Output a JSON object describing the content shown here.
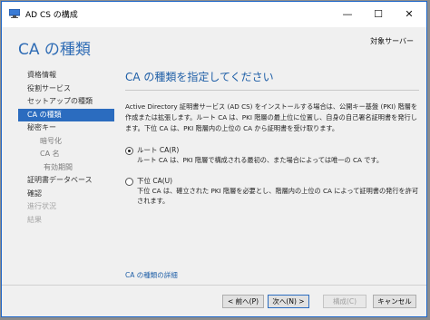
{
  "window": {
    "title": "AD CS の構成",
    "minimize_glyph": "—",
    "maximize_glyph": "☐",
    "close_glyph": "✕"
  },
  "header": {
    "page_title": "CA の種類",
    "server_label": "対象サーバー"
  },
  "nav": {
    "items": [
      {
        "label": "資格情報",
        "state": "normal"
      },
      {
        "label": "役割サービス",
        "state": "normal"
      },
      {
        "label": "セットアップの種類",
        "state": "normal"
      },
      {
        "label": "CA の種類",
        "state": "active"
      },
      {
        "label": "秘密キー",
        "state": "normal"
      },
      {
        "label": "暗号化",
        "state": "sub"
      },
      {
        "label": "CA 名",
        "state": "sub"
      },
      {
        "label": "有効期間",
        "state": "sub2"
      },
      {
        "label": "証明書データベース",
        "state": "normal"
      },
      {
        "label": "確認",
        "state": "normal"
      },
      {
        "label": "進行状況",
        "state": "disabled"
      },
      {
        "label": "結果",
        "state": "disabled"
      }
    ]
  },
  "content": {
    "title": "CA の種類を指定してください",
    "description": "Active Directory 証明書サービス (AD CS) をインストールする場合は、公開キー基盤 (PKI) 階層を作成または拡張します。ルート CA は、PKI 階層の最上位に位置し、自身の自己署名証明書を発行します。下位 CA は、PKI 階層内の上位の CA から証明書を受け取ります。",
    "options": [
      {
        "label": "ルート CA(R)",
        "desc": "ルート CA は、PKI 階層で構成される最初の、また場合によっては唯一の CA です。",
        "checked": true
      },
      {
        "label": "下位 CA(U)",
        "desc": "下位 CA は、確立された PKI 階層を必要とし、階層内の上位の CA によって証明書の発行を許可されます。",
        "checked": false
      }
    ],
    "more_link": "CA の種類の詳細"
  },
  "footer": {
    "prev": "< 前へ(P)",
    "next": "次へ(N) >",
    "configure": "構成(C)",
    "cancel": "キャンセル"
  },
  "colors": {
    "accent": "#2b6cbf",
    "title_blue": "#2f6cb5"
  }
}
